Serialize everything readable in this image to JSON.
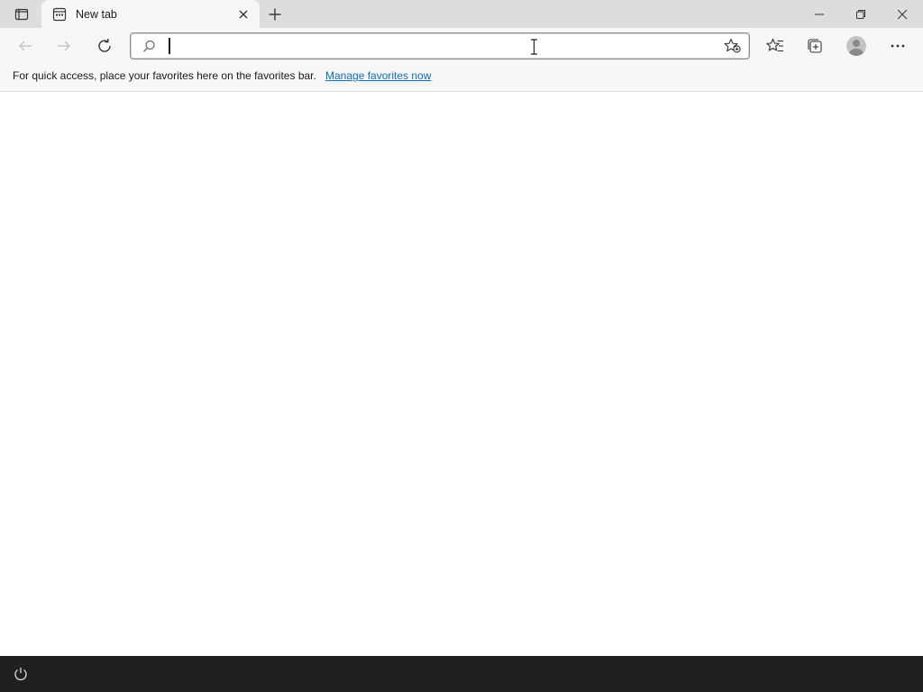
{
  "tab": {
    "title": "New tab",
    "favicon": "new-tab-page-icon",
    "close_icon": "close-icon"
  },
  "titlebar": {
    "tab_actions_icon": "tab-actions-icon",
    "new_tab_icon": "plus-icon",
    "minimize_icon": "minimize-icon",
    "restore_icon": "restore-icon",
    "close_icon": "close-icon"
  },
  "toolbar": {
    "back_icon": "arrow-left-icon",
    "forward_icon": "arrow-right-icon",
    "refresh_icon": "refresh-icon",
    "favorites_icon": "favorites-icon",
    "collections_icon": "collections-icon",
    "profile_icon": "profile-icon",
    "more_icon": "more-icon"
  },
  "addressbar": {
    "value": "",
    "placeholder": "",
    "search_icon": "search-icon",
    "add_favorite_icon": "star-add-icon"
  },
  "favorites_bar": {
    "message": "For quick access, place your favorites here on the favorites bar.",
    "manage_link": "Manage favorites now"
  },
  "bottombar": {
    "icon": "power-icon"
  },
  "colors": {
    "titlebar_bg": "#dddddd",
    "toolbar_bg": "#f7f7f7",
    "link": "#0f6cbd",
    "bottombar_bg": "#202020"
  }
}
